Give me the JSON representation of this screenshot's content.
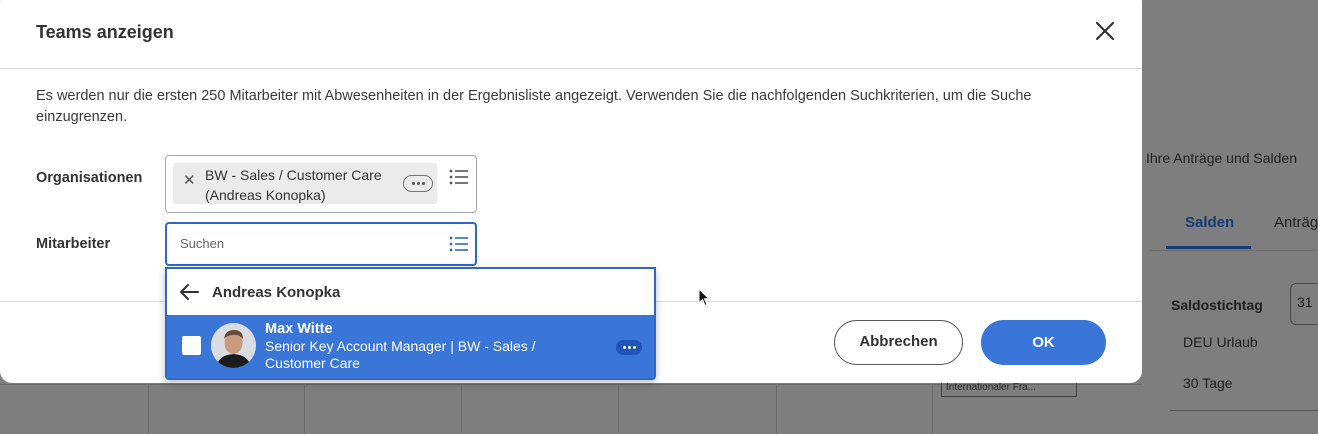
{
  "dialog": {
    "title": "Teams anzeigen",
    "info": "Es werden nur die ersten 250 Mitarbeiter mit Abwesenheiten in der Ergebnisliste angezeigt. Verwenden Sie die nachfolgenden Suchkriterien, um die Suche einzugrenzen.",
    "organisations": {
      "label": "Organisationen",
      "selected_chip_line1": "BW - Sales / Customer Care",
      "selected_chip_line2": "(Andreas Konopka)"
    },
    "employees": {
      "label": "Mitarbeiter",
      "placeholder": "Suchen"
    },
    "dropdown": {
      "header": "Andreas Konopka",
      "items": [
        {
          "name": "Max Witte",
          "subtitle": "Senior Key Account Manager | BW - Sales / Customer Care",
          "checked": false
        }
      ]
    },
    "buttons": {
      "cancel": "Abbrechen",
      "ok": "OK"
    }
  },
  "background": {
    "header_text": "Ihre Anträge und Salden",
    "tabs": [
      "Salden",
      "Anträg"
    ],
    "saldostichtag_label": "Saldostichtag",
    "date_value": "31",
    "balance_type": "DEU Urlaub",
    "balance_value": "30 Tage",
    "chip_text": "Internationaler Fra..."
  },
  "colors": {
    "primary": "#3a75d8",
    "focus_border": "#2f68c8",
    "overlay": "#7e7e7e"
  }
}
